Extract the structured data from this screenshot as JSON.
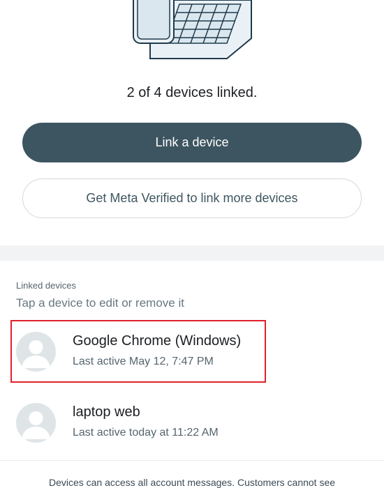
{
  "header": {
    "illustration_icon": "laptop-and-phone-illustration",
    "linked_count_text": "2 of 4 devices linked."
  },
  "actions": {
    "link_device_label": "Link a device",
    "meta_verified_label": "Get Meta Verified to link more devices"
  },
  "linked_devices": {
    "section_label": "Linked devices",
    "hint": "Tap a device to edit or remove it",
    "items": [
      {
        "name": "Google Chrome (Windows)",
        "last_active": "Last active May 12, 7:47 PM",
        "icon": "default-avatar-icon"
      },
      {
        "name": "laptop web",
        "last_active": "Last active today at 11:22 AM",
        "icon": "default-avatar-icon"
      }
    ]
  },
  "footer": {
    "note": "Devices can access all account messages. Customers cannot see"
  },
  "colors": {
    "primary_button": "#3d5560",
    "highlight": "#e0212a",
    "avatar_bg": "#dfe5e7"
  }
}
